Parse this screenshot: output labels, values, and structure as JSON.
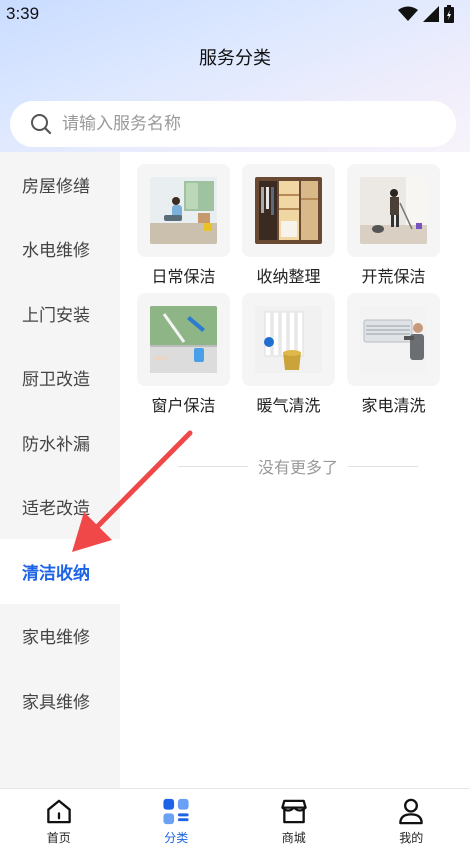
{
  "status_bar": {
    "time": "3:39"
  },
  "header": {
    "title": "服务分类"
  },
  "search": {
    "placeholder": "请输入服务名称",
    "value": ""
  },
  "sidebar": {
    "items": [
      {
        "label": "房屋修缮",
        "active": false
      },
      {
        "label": "水电维修",
        "active": false
      },
      {
        "label": "上门安装",
        "active": false
      },
      {
        "label": "厨卫改造",
        "active": false
      },
      {
        "label": "防水补漏",
        "active": false
      },
      {
        "label": "适老改造",
        "active": false
      },
      {
        "label": "清洁收纳",
        "active": true
      },
      {
        "label": "家电维修",
        "active": false
      },
      {
        "label": "家具维修",
        "active": false
      }
    ]
  },
  "services": [
    {
      "label": "日常保洁",
      "icon": "daily-cleaning-photo"
    },
    {
      "label": "收纳整理",
      "icon": "storage-organizing-photo"
    },
    {
      "label": "开荒保洁",
      "icon": "deep-cleaning-photo"
    },
    {
      "label": "窗户保洁",
      "icon": "window-cleaning-photo"
    },
    {
      "label": "暖气清洗",
      "icon": "radiator-cleaning-photo"
    },
    {
      "label": "家电清洗",
      "icon": "appliance-cleaning-photo"
    }
  ],
  "footer_note": "没有更多了",
  "tabbar": {
    "tabs": [
      {
        "label": "首页",
        "icon": "home-icon",
        "active": false
      },
      {
        "label": "分类",
        "icon": "category-icon",
        "active": true
      },
      {
        "label": "商城",
        "icon": "shop-icon",
        "active": false
      },
      {
        "label": "我的",
        "icon": "profile-icon",
        "active": false
      }
    ]
  },
  "colors": {
    "accent": "#1d63e6",
    "annotation_arrow": "#f04848"
  }
}
